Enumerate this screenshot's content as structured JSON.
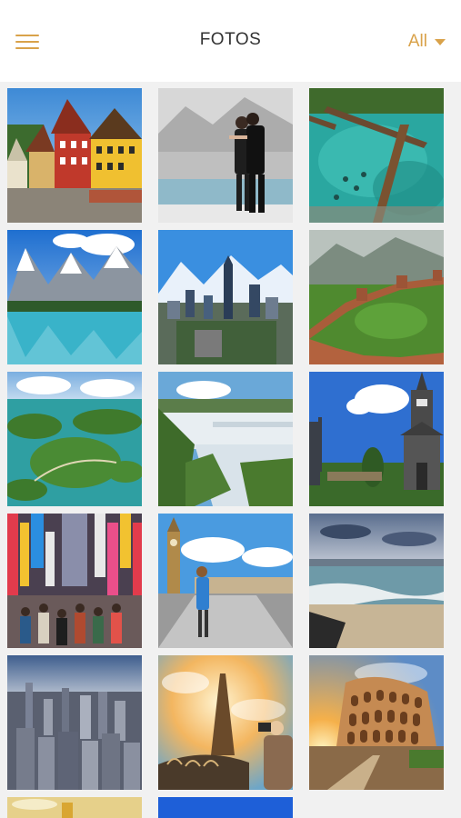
{
  "header": {
    "menu_icon": "hamburger-menu-icon",
    "title": "FOTOS",
    "filter_label": "All",
    "filter_icon": "caret-down-icon",
    "accent_color": "#d9a24a"
  },
  "photos": [
    {
      "name": "photo-colorful-timber-houses"
    },
    {
      "name": "photo-tango-dancers"
    },
    {
      "name": "photo-turquoise-lake-fallen-tree"
    },
    {
      "name": "photo-mountain-lake-reflection"
    },
    {
      "name": "photo-city-skyline-andes"
    },
    {
      "name": "photo-great-wall"
    },
    {
      "name": "photo-lagoon-islands"
    },
    {
      "name": "photo-iguazu-waterfalls"
    },
    {
      "name": "photo-wooden-church"
    },
    {
      "name": "photo-neon-street-crowd"
    },
    {
      "name": "photo-big-ben-woman"
    },
    {
      "name": "photo-beach-coastline"
    },
    {
      "name": "photo-manhattan-aerial"
    },
    {
      "name": "photo-eiffel-tower-traveler"
    },
    {
      "name": "photo-colosseum-sunset"
    },
    {
      "name": "photo-partial-golden"
    },
    {
      "name": "photo-partial-blue"
    }
  ]
}
